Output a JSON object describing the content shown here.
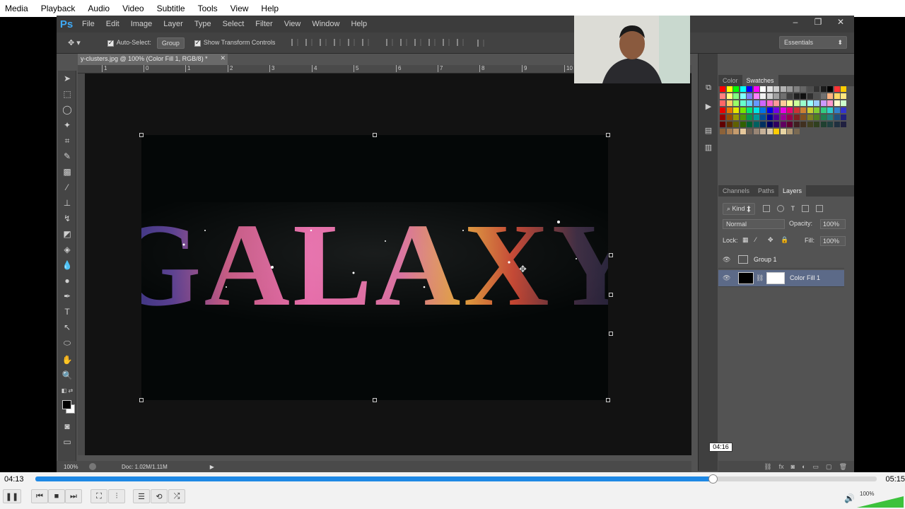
{
  "vlc": {
    "menu": [
      "Media",
      "Playback",
      "Audio",
      "Video",
      "Subtitle",
      "Tools",
      "View",
      "Help"
    ],
    "time_current": "04:13",
    "time_total": "05:15",
    "seek_fraction": 0.805,
    "hover_time": "04:16",
    "volume_label": "100%",
    "volume_level": 1.0,
    "accent": "#1e88e5"
  },
  "ps": {
    "logo": "Ps",
    "menu": [
      "File",
      "Edit",
      "Image",
      "Layer",
      "Type",
      "Select",
      "Filter",
      "View",
      "Window",
      "Help"
    ],
    "options": {
      "auto_select_label": "Auto-Select:",
      "group_value": "Group",
      "transform_label": "Show Transform Controls",
      "workspace": "Essentials"
    },
    "doc_tab": "y-clusters.jpg @ 100% (Color Fill 1, RGB/8) *",
    "ruler_labels": [
      "1",
      "0",
      "1",
      "2",
      "3",
      "4",
      "5",
      "6",
      "7",
      "8",
      "9",
      "10"
    ],
    "canvas_text": "GALAXY",
    "status": {
      "zoom": "100%",
      "doc": "Doc: 1.02M/1.11M"
    },
    "swatch_tabs": [
      "Color",
      "Swatches"
    ],
    "layer_tabs": [
      "Channels",
      "Paths",
      "Layers"
    ],
    "layers_panel": {
      "kind": "Kind",
      "blend_mode": "Normal",
      "opacity_label": "Opacity:",
      "opacity": "100%",
      "lock_label": "Lock:",
      "fill_label": "Fill:",
      "fill": "100%",
      "layers": [
        {
          "name": "Group 1",
          "selected": false
        },
        {
          "name": "Color Fill 1",
          "selected": true
        }
      ]
    }
  }
}
